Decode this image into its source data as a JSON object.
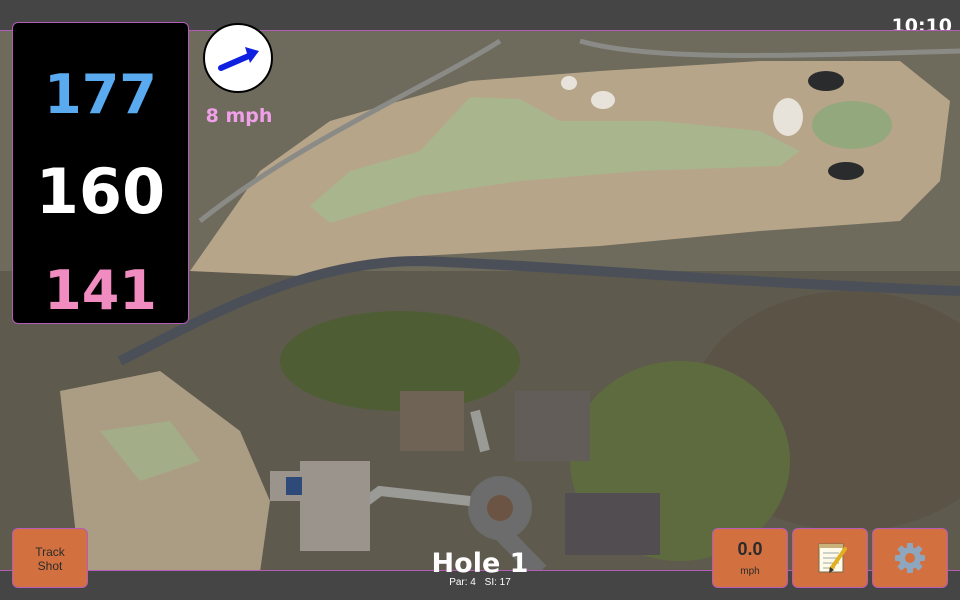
{
  "status_bar": {
    "time": "10:10"
  },
  "yardage": {
    "back": "177",
    "middle": "160",
    "front": "141",
    "colors": {
      "back": "#5aaaf0",
      "middle": "#ffffff",
      "front": "#f08cc0"
    }
  },
  "wind": {
    "speed": "8 mph",
    "icon": "wind-arrow-icon",
    "arrow_color": "#1020e0",
    "text_color": "#f0a0e8"
  },
  "hole": {
    "title": "Hole 1",
    "par": "Par: 4",
    "si": "SI: 17"
  },
  "buttons": {
    "track_shot_line1": "Track",
    "track_shot_line2": "Shot",
    "speed_value": "0.0",
    "speed_unit": "mph",
    "notes_icon": "notepad-icon",
    "settings_icon": "gear-icon"
  },
  "colors": {
    "button_bg": "#d2713f",
    "accent_border": "#b35cb8",
    "panel_bg": "#000000"
  }
}
